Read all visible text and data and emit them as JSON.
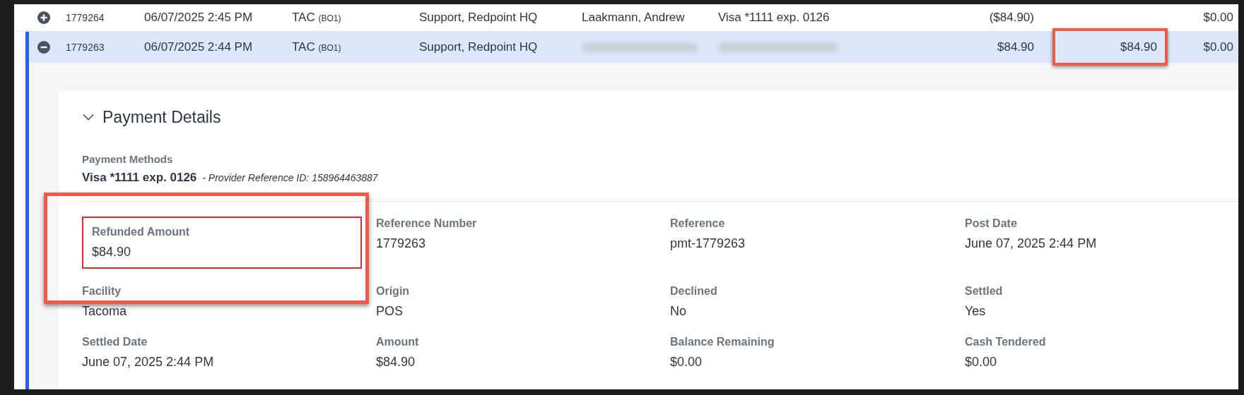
{
  "rows": [
    {
      "expanded": false,
      "selected": false,
      "id": "1779264",
      "date": "06/07/2025 2:45 PM",
      "facility": "TAC",
      "facility_code": "(BO1)",
      "user": "Support, Redpoint HQ",
      "redacted": false,
      "customer": "Laakmann, Andrew",
      "payment_method": "Visa *1111 exp. 0126",
      "column_7": "($84.90)",
      "column_9": "$0.00"
    },
    {
      "expanded": true,
      "selected": true,
      "id": "1779263",
      "date": "06/07/2025 2:44 PM",
      "facility": "TAC",
      "facility_code": "(BO1)",
      "user": "Support, Redpoint HQ",
      "redacted": true,
      "column_7": "$84.90",
      "column_8": "$84.90",
      "column_8_highlighted": true,
      "column_9": "$0.00"
    }
  ],
  "details": {
    "title": "Payment Details",
    "expanded": true,
    "callout": true,
    "payment_methods_label": "Payment Methods",
    "payment_method": "Visa *1111 exp. 0126",
    "provider_reference": "- Provider Reference ID: 158964463887",
    "fields": [
      {
        "label": "Refunded Amount",
        "value": "$84.90",
        "highlighted": true
      },
      {
        "label": "Reference Number",
        "value": "1779263",
        "highlighted": false
      },
      {
        "label": "Reference",
        "value": "pmt-1779263",
        "highlighted": false
      },
      {
        "label": "Post Date",
        "value": "June 07, 2025 2:44 PM",
        "highlighted": false
      },
      {
        "label": "Facility",
        "value": "Tacoma",
        "highlighted": false
      },
      {
        "label": "Origin",
        "value": "POS",
        "highlighted": false
      },
      {
        "label": "Declined",
        "value": "No",
        "highlighted": false
      },
      {
        "label": "Settled",
        "value": "Yes",
        "highlighted": false
      },
      {
        "label": "Settled Date",
        "value": "June 07, 2025 2:44 PM",
        "highlighted": false
      },
      {
        "label": "Amount",
        "value": "$84.90",
        "highlighted": false
      },
      {
        "label": "Balance Remaining",
        "value": "$0.00",
        "highlighted": false
      },
      {
        "label": "Cash Tendered",
        "value": "$0.00",
        "highlighted": false
      }
    ]
  }
}
